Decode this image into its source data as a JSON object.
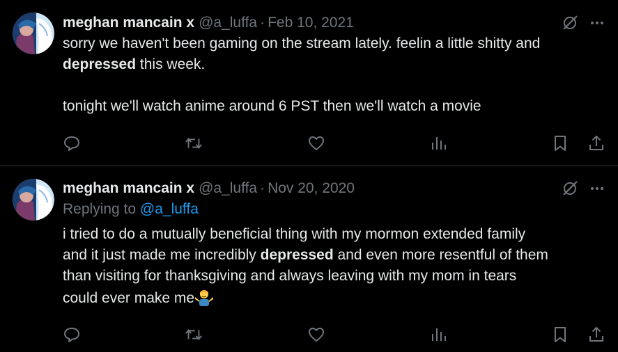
{
  "colors": {
    "background": "#000000",
    "text": "#e7e9ea",
    "muted": "#71767b",
    "link": "#1d9bf0",
    "divider": "#2f3336"
  },
  "tweets": [
    {
      "display_name": "meghan mancain x",
      "handle": "@a_luffa",
      "separator": "·",
      "date": "Feb 10, 2021",
      "body_line1_before": "sorry we haven't been gaming on the stream lately. feelin a little shitty and",
      "body_bold": "depressed",
      "body_line2_after": " this week.",
      "body_para2": "tonight we'll watch anime around 6 PST then we'll watch a movie",
      "icons": [
        "grok-icon",
        "more-icon",
        "reply-icon",
        "retweet-icon",
        "like-icon",
        "views-icon",
        "bookmark-icon",
        "share-icon"
      ]
    },
    {
      "display_name": "meghan mancain x",
      "handle": "@a_luffa",
      "separator": "·",
      "date": "Nov 20, 2020",
      "replying_prefix": "Replying to ",
      "replying_handle": "@a_luffa",
      "body_line1": "i tried to do a mutually beneficial thing with my mormon extended family",
      "body_line2_before": "and it just made me incredibly ",
      "body_bold": "depressed",
      "body_line2_after": " and even more resentful of them",
      "body_line3": "than visiting for thanksgiving and always leaving with my mom in tears",
      "body_line4": "could ever make me",
      "emoji": "person-shrugging-emoji",
      "icons": [
        "grok-icon",
        "more-icon",
        "reply-icon",
        "retweet-icon",
        "like-icon",
        "views-icon",
        "bookmark-icon",
        "share-icon"
      ]
    }
  ]
}
